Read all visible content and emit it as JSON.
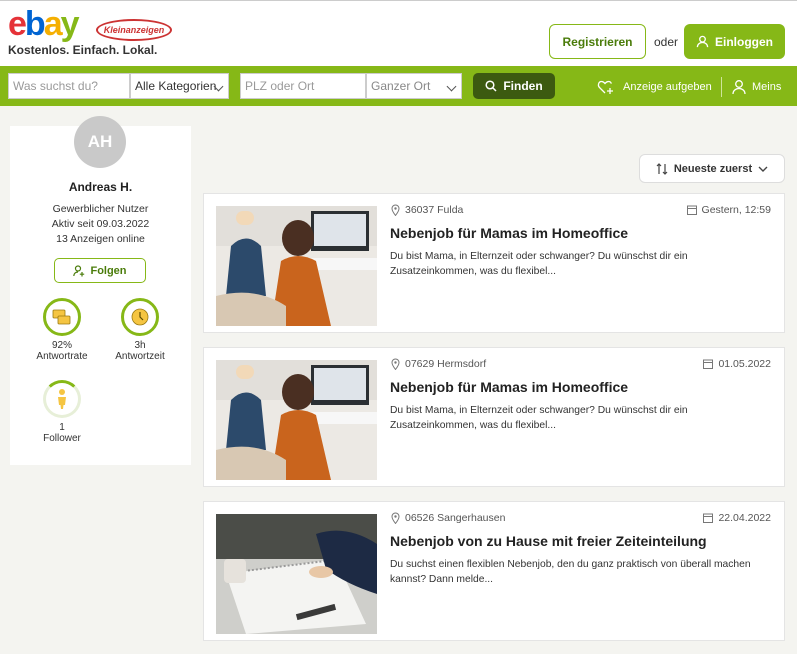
{
  "header": {
    "logo_text": "ebay",
    "logo_badge": "Kleinanzeigen",
    "tagline": "Kostenlos. Einfach. Lokal.",
    "register_label": "Registrieren",
    "or_label": "oder",
    "login_label": "Einloggen"
  },
  "search": {
    "query_placeholder": "Was suchst du?",
    "category_value": "Alle Kategorien",
    "location_placeholder": "PLZ oder Ort",
    "radius_value": "Ganzer Ort",
    "find_label": "Finden",
    "post_ad_label": "Anzeige aufgeben",
    "account_label": "Meins"
  },
  "profile": {
    "initials": "AH",
    "name": "Andreas H.",
    "type": "Gewerblicher Nutzer",
    "active_since": "Aktiv seit 09.03.2022",
    "ads_online": "13 Anzeigen online",
    "follow_label": "Folgen",
    "stats": [
      {
        "value": "92%",
        "label": "Antwortrate"
      },
      {
        "value": "3h",
        "label": "Antwortzeit"
      },
      {
        "value": "1",
        "label": "Follower"
      }
    ]
  },
  "sort_label": "Neueste zuerst",
  "listings": [
    {
      "location": "36037 Fulda",
      "date": "Gestern, 12:59",
      "title": "Nebenjob für Mamas im Homeoffice",
      "description": "Du bist Mama, in Elternzeit oder schwanger? Du wünschst dir ein Zusatzeinkommen, was du flexibel..."
    },
    {
      "location": "07629 Hermsdorf",
      "date": "01.05.2022",
      "title": "Nebenjob für Mamas im Homeoffice",
      "description": "Du bist Mama, in Elternzeit oder schwanger? Du wünschst dir ein Zusatzeinkommen, was du flexibel..."
    },
    {
      "location": "06526 Sangerhausen",
      "date": "22.04.2022",
      "title": "Nebenjob von zu Hause mit freier Zeiteinteilung",
      "description": "Du suchst einen flexiblen Nebenjob, den du ganz praktisch von überall machen kannst? Dann melde..."
    }
  ],
  "colors": {
    "brand_green": "#86b817",
    "dark_green": "#3c5a10"
  }
}
